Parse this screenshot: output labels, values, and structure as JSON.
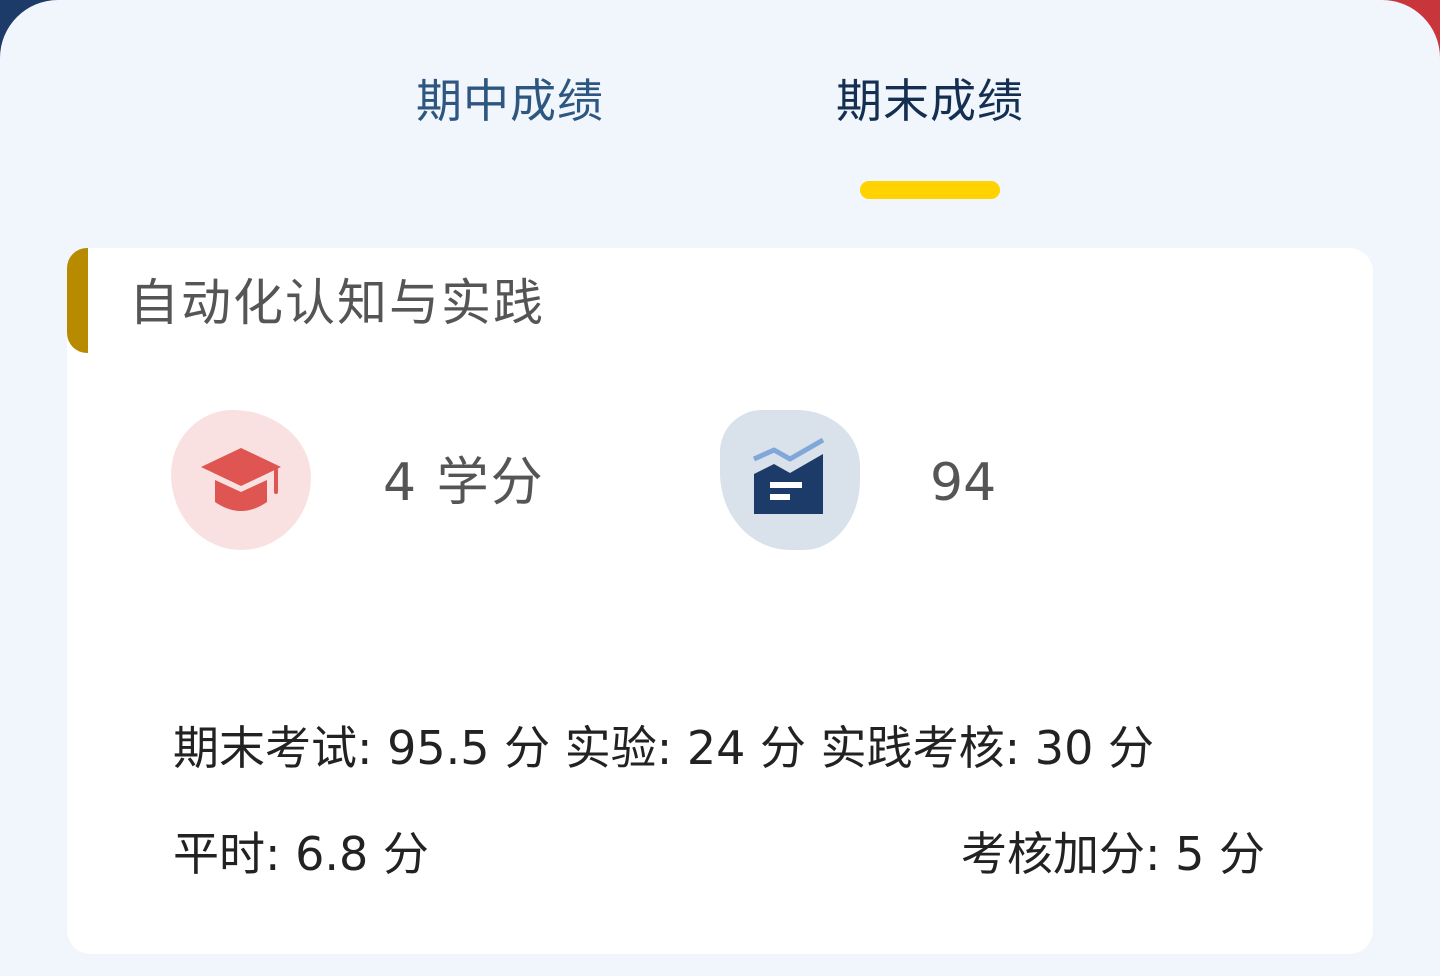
{
  "tabs": [
    {
      "label": "期中成绩",
      "active": false
    },
    {
      "label": "期末成绩",
      "active": true
    }
  ],
  "colors": {
    "tab_indicator": "#ffd200",
    "card_accent": "#b78a00",
    "credit_blob": "#f9e1e1",
    "credit_icon": "#de5552",
    "score_blob": "#d9e1ea",
    "score_icon": "#1c3b68",
    "score_icon_line": "#7fa7d9"
  },
  "course": {
    "title": "自动化认知与实践",
    "credit_icon": "graduation-cap-icon",
    "score_icon": "grade-report-icon",
    "credits": "4 学分",
    "score": "94",
    "details": {
      "row1": "期末考试: 95.5 分 实验: 24 分 实践考核: 30 分",
      "usual": "平时: 6.8 分",
      "bonus": "考核加分: 5 分"
    }
  }
}
